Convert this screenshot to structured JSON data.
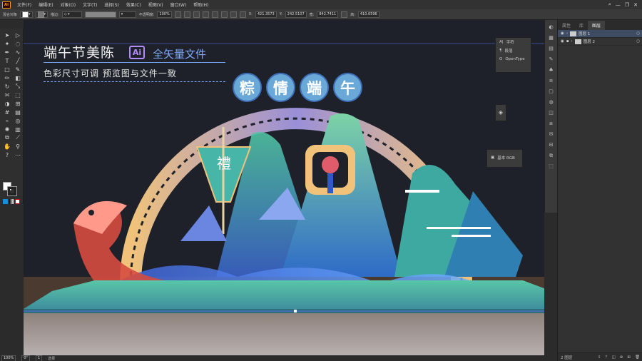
{
  "app": {
    "logo_text": "Ai"
  },
  "menu": {
    "items": [
      "文件(F)",
      "编辑(E)",
      "对象(O)",
      "文字(T)",
      "选择(S)",
      "效果(C)",
      "视图(V)",
      "窗口(W)",
      "帮助(H)"
    ]
  },
  "window_controls": {
    "search": "⌕",
    "minimize": "—",
    "restore": "❐",
    "close": "✕"
  },
  "control_bar": {
    "selection_label": "混合对象",
    "stroke_label": "描边:",
    "opacity_label": "不透明度:",
    "opacity_value": "100%",
    "x_label": "X:",
    "x_value": "421.3573",
    "y_label": "Y:",
    "y_value": "242.5107",
    "w_label": "宽:",
    "w_value": "842.7411",
    "h_label": "高:",
    "h_value": "410.6596",
    "unit": "pt"
  },
  "artwork": {
    "title": "端午节美陈",
    "ai_badge": "Ai",
    "tag": "全矢量文件",
    "subtitle": "色彩尺寸可调  预览图与文件一致",
    "banner_chars": [
      "粽",
      "情",
      "端",
      "午"
    ],
    "flag_char": "禮"
  },
  "floating_char_panel": {
    "items": [
      "字符",
      "段落",
      "OpenType"
    ]
  },
  "floating_color_panel": {
    "label": "基本 RGB"
  },
  "layers_panel": {
    "tabs": [
      "属性",
      "库",
      "图层"
    ],
    "layers": [
      {
        "name": "图层 1",
        "selected": true
      },
      {
        "name": "图层 2",
        "selected": false
      }
    ],
    "footer_count": "2 图层"
  },
  "status_bar": {
    "zoom": "100%",
    "rotation": "0°",
    "artboard": "1",
    "mode": "选择"
  },
  "colors": {
    "accent": "#ff9a00",
    "background": "#1e2129",
    "highlight": "#3d4b63"
  }
}
